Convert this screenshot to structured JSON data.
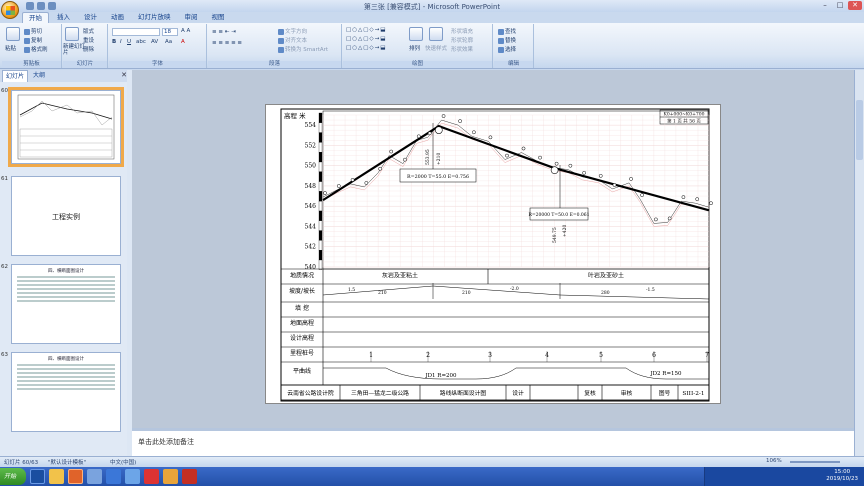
{
  "window": {
    "title": "第三张 [兼容模式] - Microsoft PowerPoint"
  },
  "ribbon": {
    "tabs": [
      "开始",
      "插入",
      "设计",
      "动画",
      "幻灯片放映",
      "审阅",
      "视图"
    ],
    "active_tab": "开始",
    "groups": [
      "剪贴板",
      "幻灯片",
      "字体",
      "段落",
      "绘图",
      "编辑"
    ],
    "clipboard": {
      "paste": "粘贴",
      "cut": "剪切",
      "copy": "复制",
      "format_painter": "格式刷"
    },
    "slides": {
      "new_slide": "新建幻灯片",
      "layout": "版式",
      "reset": "重设",
      "delete": "删除"
    },
    "font": {
      "size": "18"
    },
    "paragraph": {
      "text_direction": "文字方向",
      "align_text": "对齐文本",
      "smartart": "转换为 SmartArt"
    },
    "drawing": {
      "arrange": "排列",
      "quick_styles": "快速样式",
      "shape_fill": "形状填充",
      "shape_outline": "形状轮廓",
      "shape_effects": "形状效果"
    },
    "editing": {
      "find": "查找",
      "replace": "替换",
      "select": "选择"
    }
  },
  "left_panel": {
    "tabs": [
      "幻灯片",
      "大纲"
    ],
    "thumbs": [
      {
        "num": "60",
        "title": ""
      },
      {
        "num": "61",
        "title": "工程实例"
      },
      {
        "num": "62",
        "title": "四、横断面图设计"
      },
      {
        "num": "63",
        "title": "四、横断面图设计"
      }
    ]
  },
  "slide": {
    "header_box": [
      "K0+000~K0+700",
      "第 1 页  共 56 页"
    ],
    "elevation_label": "高程 米",
    "y_ticks": [
      "554",
      "552",
      "550",
      "548",
      "546",
      "544",
      "542",
      "540"
    ],
    "row_labels": [
      "地质情况",
      "坡度/坡长",
      "填 挖",
      "地面高程",
      "设计高程",
      "里程桩号",
      "平曲线"
    ],
    "geology": [
      "灰岩及亚粘土",
      "叶岩及亚砂土"
    ],
    "vertical_curves": [
      {
        "text": "R=2000  T=55.0  E=0.756",
        "station": "553.95",
        "offset": "+210"
      },
      {
        "text": "R=20000 T=50.0 E=0.061",
        "station": "549.75",
        "offset": "+420"
      }
    ],
    "grades": [
      {
        "grade": "1.5",
        "length": "210"
      },
      {
        "grade": "-2.0",
        "length": "210"
      },
      {
        "grade": "-1.5",
        "length": "280"
      }
    ],
    "stations": [
      "1",
      "2",
      "3",
      "4",
      "5",
      "6",
      "7"
    ],
    "curves": [
      "JD1  R=200",
      "JD2  R=150"
    ],
    "footer": [
      "云南省公路设计院",
      "三角田—猛龙二级公路",
      "路线纵断面设计图",
      "设计",
      "复核",
      "审核",
      "图号",
      "SIII-2-1"
    ]
  },
  "notes": {
    "placeholder": "单击此处添加备注"
  },
  "status": {
    "slide_index": "幻灯片 60/63",
    "theme": "\"默认设计模板\"",
    "language": "中文(中国)",
    "zoom": "106%"
  },
  "taskbar": {
    "start": "开始",
    "time": "15:00",
    "date": "2019/10/23"
  },
  "chart_data": {
    "type": "line",
    "title": "",
    "ylabel": "高程 米",
    "ylim": [
      540,
      555
    ],
    "xlim": [
      0,
      700
    ],
    "grid": true,
    "series": [
      {
        "name": "",
        "values": [
          [
            0,
            546.6
          ],
          [
            210,
            553.9
          ],
          [
            420,
            549.75
          ],
          [
            700,
            545.6
          ]
        ]
      },
      {
        "name": "",
        "values": [
          [
            0,
            546.9
          ],
          [
            25,
            547.6
          ],
          [
            50,
            548.2
          ],
          [
            75,
            547.9
          ],
          [
            100,
            549.3
          ],
          [
            120,
            551.0
          ],
          [
            145,
            550.2
          ],
          [
            170,
            552.5
          ],
          [
            190,
            552.8
          ],
          [
            215,
            554.5
          ],
          [
            245,
            554.0
          ],
          [
            270,
            552.9
          ],
          [
            300,
            552.4
          ],
          [
            330,
            550.6
          ],
          [
            360,
            551.3
          ],
          [
            390,
            550.4
          ],
          [
            420,
            549.8
          ],
          [
            445,
            549.6
          ],
          [
            470,
            548.9
          ],
          [
            500,
            548.6
          ],
          [
            525,
            547.7
          ],
          [
            555,
            548.3
          ],
          [
            575,
            546.7
          ],
          [
            600,
            544.3
          ],
          [
            625,
            544.4
          ],
          [
            650,
            546.5
          ],
          [
            675,
            546.3
          ],
          [
            700,
            545.9
          ]
        ]
      }
    ]
  }
}
